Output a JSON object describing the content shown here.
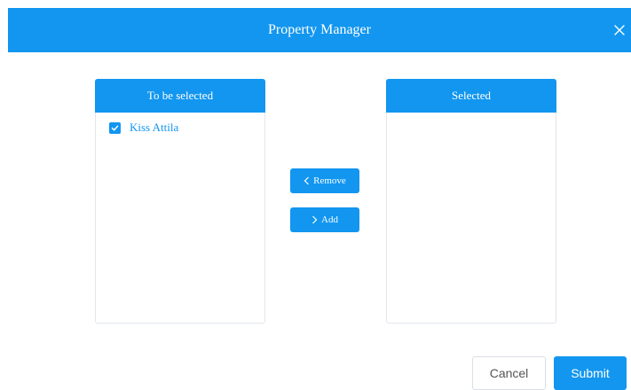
{
  "dialog": {
    "title": "Property Manager"
  },
  "left_panel": {
    "title": "To be selected",
    "items": [
      {
        "label": "Kiss Attila",
        "checked": true
      }
    ]
  },
  "right_panel": {
    "title": "Selected",
    "items": []
  },
  "transfer": {
    "remove_label": "Remove",
    "add_label": "Add"
  },
  "footer": {
    "cancel_label": "Cancel",
    "submit_label": "Submit"
  },
  "icons": {
    "close": "close-icon",
    "checkbox": "check-icon",
    "remove": "chevron-left-icon",
    "add": "chevron-right-icon"
  },
  "colors": {
    "primary": "#1296f0",
    "border": "#e1e6ec",
    "text_muted": "#555555"
  }
}
